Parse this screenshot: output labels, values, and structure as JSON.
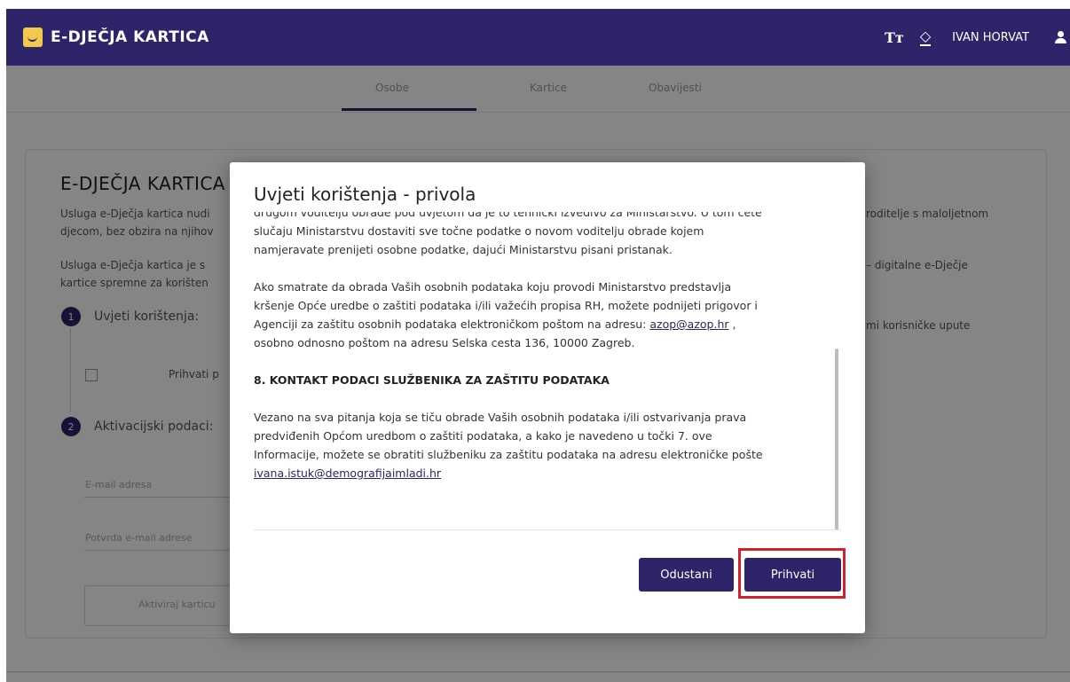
{
  "header": {
    "app_title": "E-DJEČJA KARTICA",
    "font_size_icon": "Tт",
    "paint_icon": "◇",
    "username": "IVAN HORVAT",
    "logo_icon": "smile-logo",
    "user_icon": "person-icon"
  },
  "tabs": [
    "Osobe",
    "Kartice",
    "Obavijesti"
  ],
  "background": {
    "page_title": "E-DJEČJA KARTICA",
    "intro_1a": "Usluga e-Dječja kartica nudi",
    "intro_1b": "roditelje s maloljetnom",
    "intro_2a": "djecom, bez obzira na njihov",
    "intro_3a": "Usluga e-Dječja kartica je s",
    "intro_3b": "– digitalne e-Dječje",
    "intro_4a": "kartice spremne za korišten",
    "intro_help": "mi korisničke upute",
    "step1_num": "1",
    "step1_label": "Uvjeti korištenja:",
    "accept_label": "Prihvati p",
    "step2_num": "2",
    "step2_label": "Aktivacijski podaci:",
    "email_placeholder": "E-mail adresa",
    "email_confirm_placeholder": "Potvrda e-mail adrese",
    "activate_button": "Aktiviraj karticu"
  },
  "modal": {
    "title": "Uvjeti korištenja - privola",
    "para1": [
      "drugom voditelju obrade pod uvjetom da je to tehnički izvedivo za Ministarstvo. U tom ćete",
      "slučaju Ministarstvu dostaviti sve točne podatke o novom voditelju obrade kojem",
      "namjeravate prenijeti osobne podatke, dajući Ministarstvu pisani pristanak."
    ],
    "para2_line1": "Ako smatrate da obrada Vaših osobnih podataka koju provodi Ministarstvo predstavlja",
    "para2_line2": "kršenje Opće uredbe o zaštiti podataka i/ili važećih propisa RH, možete podnijeti prigovor i",
    "para2_line3_pre": "Agenciji za zaštitu osobnih podataka elektroničkom poštom na adresu: ",
    "para2_email": "azop@azop.hr",
    "para2_line3_post": " ,",
    "para2_line4": "osobno odnosno poštom na adresu Selska cesta 136, 10000 Zagreb.",
    "section8_heading": "8. KONTAKT PODACI SLUŽBENIKA ZA ZAŠTITU PODATAKA",
    "para3_line1": "Vezano na sva pitanja koja se tiču obrade Vaših osobnih podataka i/ili ostvarivanja prava",
    "para3_line2": "predviđenih Općom uredbom o zaštiti podataka, a kako je navedeno u točki 7. ove",
    "para3_line3": "Informacije, možete se obratiti službeniku za zaštitu podataka na adresu elektroničke pošte",
    "para3_email": "ivana.istuk@demografijaimladi.hr",
    "cancel_label": "Odustani",
    "accept_label": "Prihvati"
  },
  "colors": {
    "brand": "#2d2469",
    "highlight": "#d3202a"
  }
}
